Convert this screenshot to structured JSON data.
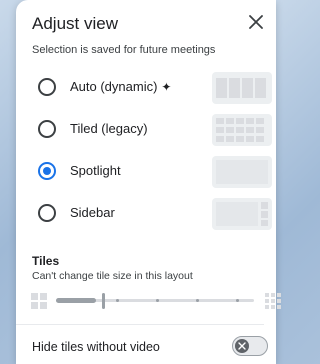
{
  "dialog": {
    "title": "Adjust view",
    "subtitle": "Selection is saved for future meetings",
    "close_icon": "close-icon"
  },
  "options": [
    {
      "label": "Auto (dynamic)",
      "icon": "sparkle-icon",
      "checked": false,
      "preview": "grid-4"
    },
    {
      "label": "Tiled (legacy)",
      "checked": false,
      "preview": "grid-dense"
    },
    {
      "label": "Spotlight",
      "checked": true,
      "preview": "single"
    },
    {
      "label": "Sidebar",
      "checked": false,
      "preview": "sidebar"
    }
  ],
  "tiles": {
    "heading": "Tiles",
    "note": "Can't change tile size in this layout",
    "slider_value_fraction": 0.2,
    "slider_disabled": true
  },
  "hide_tiles": {
    "label": "Hide tiles without video",
    "enabled": false
  },
  "colors": {
    "accent": "#1a73e8",
    "text": "#202124",
    "muted": "#9aa0a6"
  }
}
